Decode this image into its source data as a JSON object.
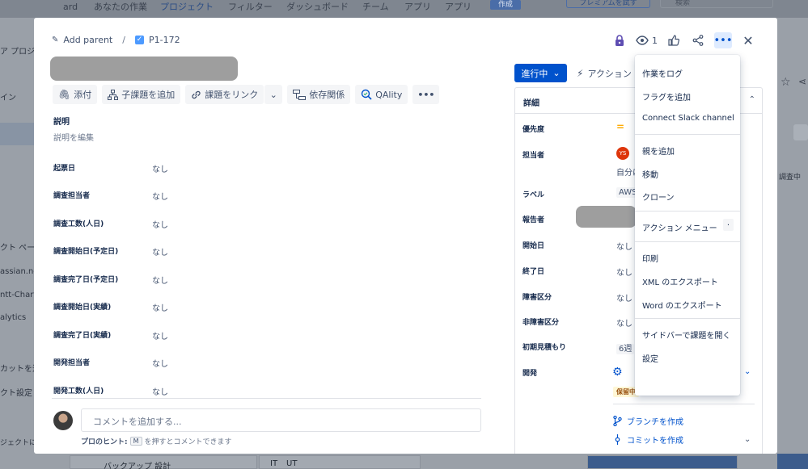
{
  "background": {
    "topnav": [
      "ard",
      "あなたの作業",
      "プロジェクト",
      "アプリ",
      "フィルター",
      "ダッシュボード",
      "チーム",
      "アプリ",
      "アプリ"
    ],
    "create_button": "作成",
    "premium_button": "プレミアムを試す",
    "search_placeholder": "検索",
    "left_items": [
      "ア プロジェ",
      "イン",
      "クト ペー",
      "assian.ne",
      "ntt-Chart",
      "alytics",
      "カットを追",
      "クト設定",
      "ジェクトに"
    ],
    "right_items": [
      "調査中"
    ],
    "bottom_items": [
      "バックアップ 設計",
      "IT",
      "UT"
    ]
  },
  "modal": {
    "breadcrumb": {
      "add_parent": "Add parent",
      "issue_key": "P1-172"
    },
    "watch_count": "1",
    "toolbar": {
      "attach": "添付",
      "add_subtask": "子課題を追加",
      "link_issue": "課題をリンク",
      "dependencies": "依存関係",
      "qality": "QAlity"
    },
    "description": {
      "title": "説明",
      "edit": "説明を編集"
    },
    "fields": [
      {
        "label": "起票日",
        "value": "なし"
      },
      {
        "label": "調査担当者",
        "value": "なし"
      },
      {
        "label": "調査工数(人日)",
        "value": "なし"
      },
      {
        "label": "調査開始日(予定日)",
        "value": "なし"
      },
      {
        "label": "調査完了日(予定日)",
        "value": "なし"
      },
      {
        "label": "調査開始日(実績)",
        "value": "なし"
      },
      {
        "label": "調査完了日(実績)",
        "value": "なし"
      },
      {
        "label": "開発担当者",
        "value": "なし"
      },
      {
        "label": "開発工数(人日)",
        "value": "なし"
      }
    ],
    "comment": {
      "placeholder": "コメントを追加する...",
      "tip_label": "プロのヒント:",
      "tip_key": "M",
      "tip_text": "を押すとコメントできます"
    },
    "status": "進行中",
    "action": "アクション",
    "details": {
      "title": "詳細",
      "rows": [
        {
          "label": "優先度",
          "value": ""
        },
        {
          "label": "担当者",
          "value": "自分に"
        },
        {
          "label": "ラベル",
          "value": "AWS"
        },
        {
          "label": "報告者",
          "value": ""
        },
        {
          "label": "開始日",
          "value": "なし"
        },
        {
          "label": "終了日",
          "value": "なし"
        },
        {
          "label": "障害区分",
          "value": "なし"
        },
        {
          "label": "非障害区分",
          "value": "なし"
        },
        {
          "label": "初期見積もり",
          "value": "6週"
        },
        {
          "label": "開発",
          "value": ""
        }
      ],
      "assignee_initials": "YS",
      "dev_status": "保留中",
      "create_branch": "ブランチを作成",
      "create_commit": "コミットを作成"
    },
    "menu": {
      "items": [
        "作業をログ",
        "フラグを追加",
        "Connect Slack channel",
        "親を追加",
        "移動",
        "クローン",
        "アクション メニュー",
        "印刷",
        "XML のエクスポート",
        "Word のエクスポート",
        "サイドバーで課題を開く",
        "設定"
      ],
      "shortcut": "."
    }
  }
}
